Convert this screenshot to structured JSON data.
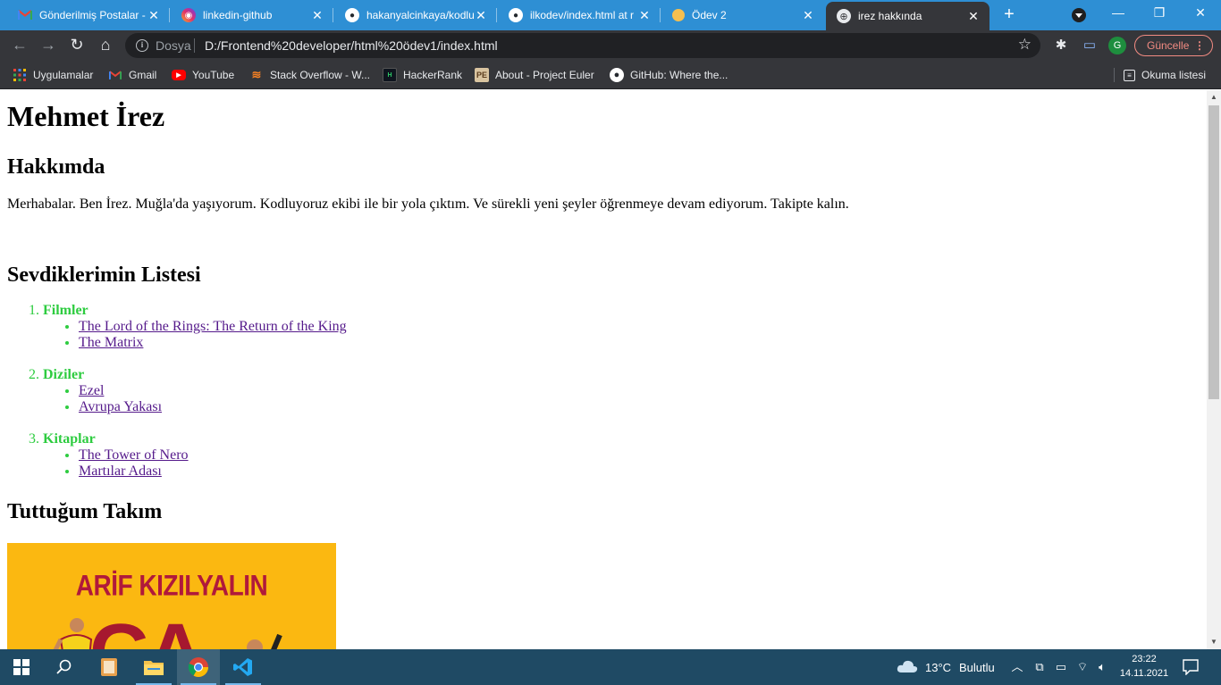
{
  "browser": {
    "tabs": [
      {
        "title": "Gönderilmiş Postalar -",
        "icon": "gmail-icon",
        "active": false
      },
      {
        "title": "linkedin-github",
        "icon": "instagram-icon",
        "active": false
      },
      {
        "title": "hakanyalcinkaya/kodlu",
        "icon": "github-icon",
        "active": false
      },
      {
        "title": "ilkodev/index.html at r",
        "icon": "github-icon",
        "active": false
      },
      {
        "title": "Ödev 2",
        "icon": "circle-icon",
        "active": false
      },
      {
        "title": "irez hakkında",
        "icon": "globe-icon",
        "active": true
      }
    ],
    "new_tab_symbol": "+",
    "window_controls": {
      "minimize": "—",
      "restore": "❐",
      "close": "✕"
    },
    "omnibox": {
      "scheme_label": "Dosya",
      "url": "D:/Frontend%20developer/html%20ödev1/index.html"
    },
    "profile_initial": "G",
    "update_label": "Güncelle",
    "bookmarks": [
      {
        "label": "Uygulamalar",
        "icon": "apps-grid-icon"
      },
      {
        "label": "Gmail",
        "icon": "gmail-icon"
      },
      {
        "label": "YouTube",
        "icon": "youtube-icon"
      },
      {
        "label": "Stack Overflow - W...",
        "icon": "stackoverflow-icon"
      },
      {
        "label": "HackerRank",
        "icon": "hackerrank-icon"
      },
      {
        "label": "About - Project Euler",
        "icon": "project-euler-icon"
      },
      {
        "label": "GitHub: Where the...",
        "icon": "github-icon"
      }
    ],
    "reading_list_label": "Okuma listesi"
  },
  "page": {
    "name": "Mehmet İrez",
    "about_heading": "Hakkımda",
    "about_text": "Merhabalar. Ben İrez. Muğla'da yaşıyorum. Kodluyoruz ekibi ile bir yola çıktım. Ve sürekli yeni şeyler öğrenmeye devam ediyorum. Takipte kalın.",
    "list_heading": "Sevdiklerimin Listesi",
    "categories": [
      {
        "label": "Filmler",
        "items": [
          "The Lord of the Rings: The Return of the King",
          "The Matrix"
        ]
      },
      {
        "label": "Diziler",
        "items": [
          "Ezel",
          "Avrupa Yakası"
        ]
      },
      {
        "label": "Kitaplar",
        "items": [
          "The Tower of Nero",
          "Martılar Adası"
        ]
      }
    ],
    "team_heading": "Tuttuğum Takım",
    "team_image": {
      "headline": "ARİF KIZILYALIN",
      "big_text": "GA"
    }
  },
  "taskbar": {
    "weather": {
      "temperature": "13°C",
      "condition": "Bulutlu"
    },
    "clock": {
      "time": "23:22",
      "date": "14.11.2021"
    }
  },
  "colors": {
    "tab_strip": "#2e8fd4",
    "toolbar": "#35363a",
    "list_accent": "#2ecc40",
    "visited_link": "#551a8b",
    "taskbar": "#1f4a64",
    "team_yellow": "#fbb811",
    "team_red": "#a6182f"
  }
}
